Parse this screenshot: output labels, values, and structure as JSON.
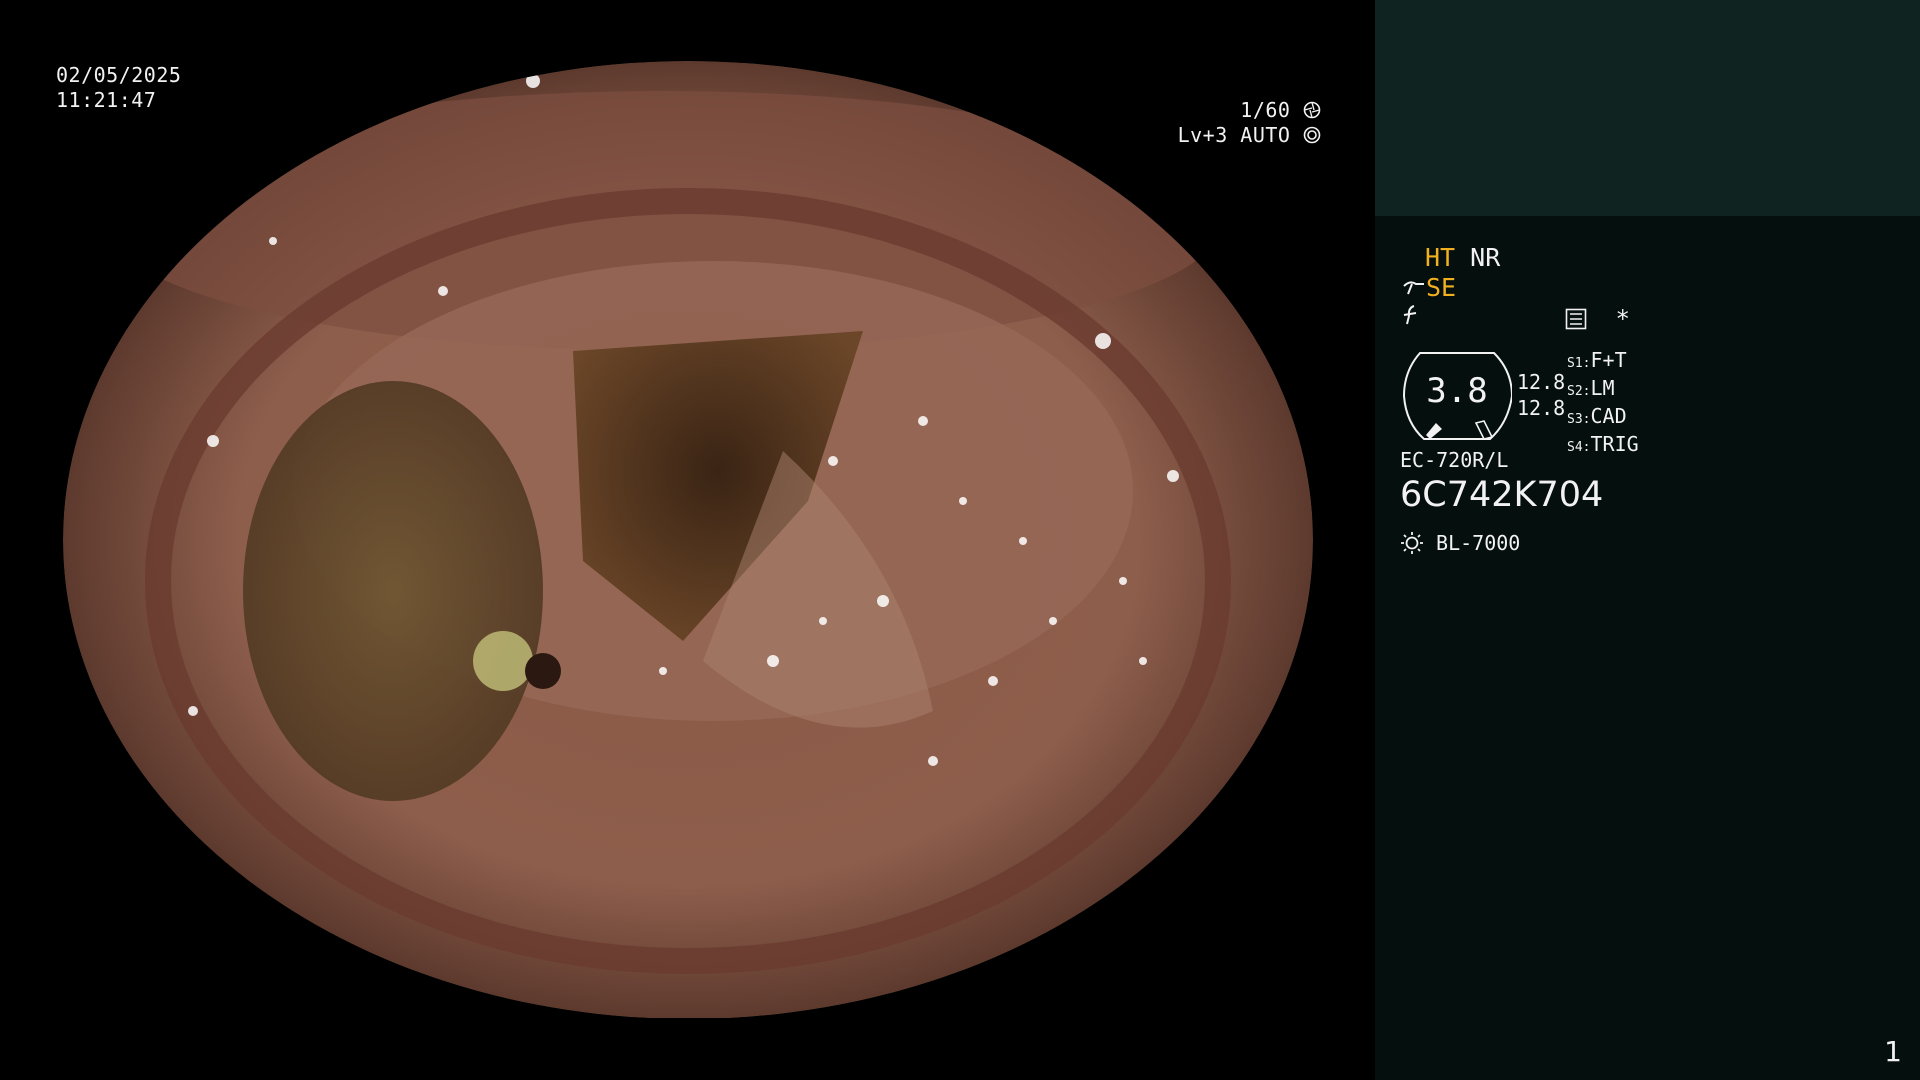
{
  "overlay": {
    "date": "02/05/2025",
    "time": "11:21:47",
    "shutter": "1/60",
    "level_mode": "Lv+3 AUTO"
  },
  "panel": {
    "ht": "HT",
    "nr": "NR",
    "se": "SE",
    "menu_star": "*",
    "dial_value": "3.8",
    "rl_values": [
      "12.8",
      "12.8"
    ],
    "slots": [
      {
        "tag": "S1:",
        "value": "F+T"
      },
      {
        "tag": "S2:",
        "value": "LM"
      },
      {
        "tag": "S3:",
        "value": "CAD"
      },
      {
        "tag": "S4:",
        "value": "TRIG"
      }
    ],
    "scope_model": "EC-720R/L",
    "scope_serial": "6C742K704",
    "light_source": "BL-7000",
    "page_number": "1"
  },
  "colors": {
    "accent_yellow": "#f0b020",
    "panel_bg": "#050f0d",
    "panel_top_bg": "#0f2420",
    "text": "#f2f2f2"
  },
  "icons": [
    "shutter-icon",
    "auto-iris-icon",
    "scope-tip-icon",
    "freeze-icon",
    "menu-icon",
    "light-icon"
  ]
}
